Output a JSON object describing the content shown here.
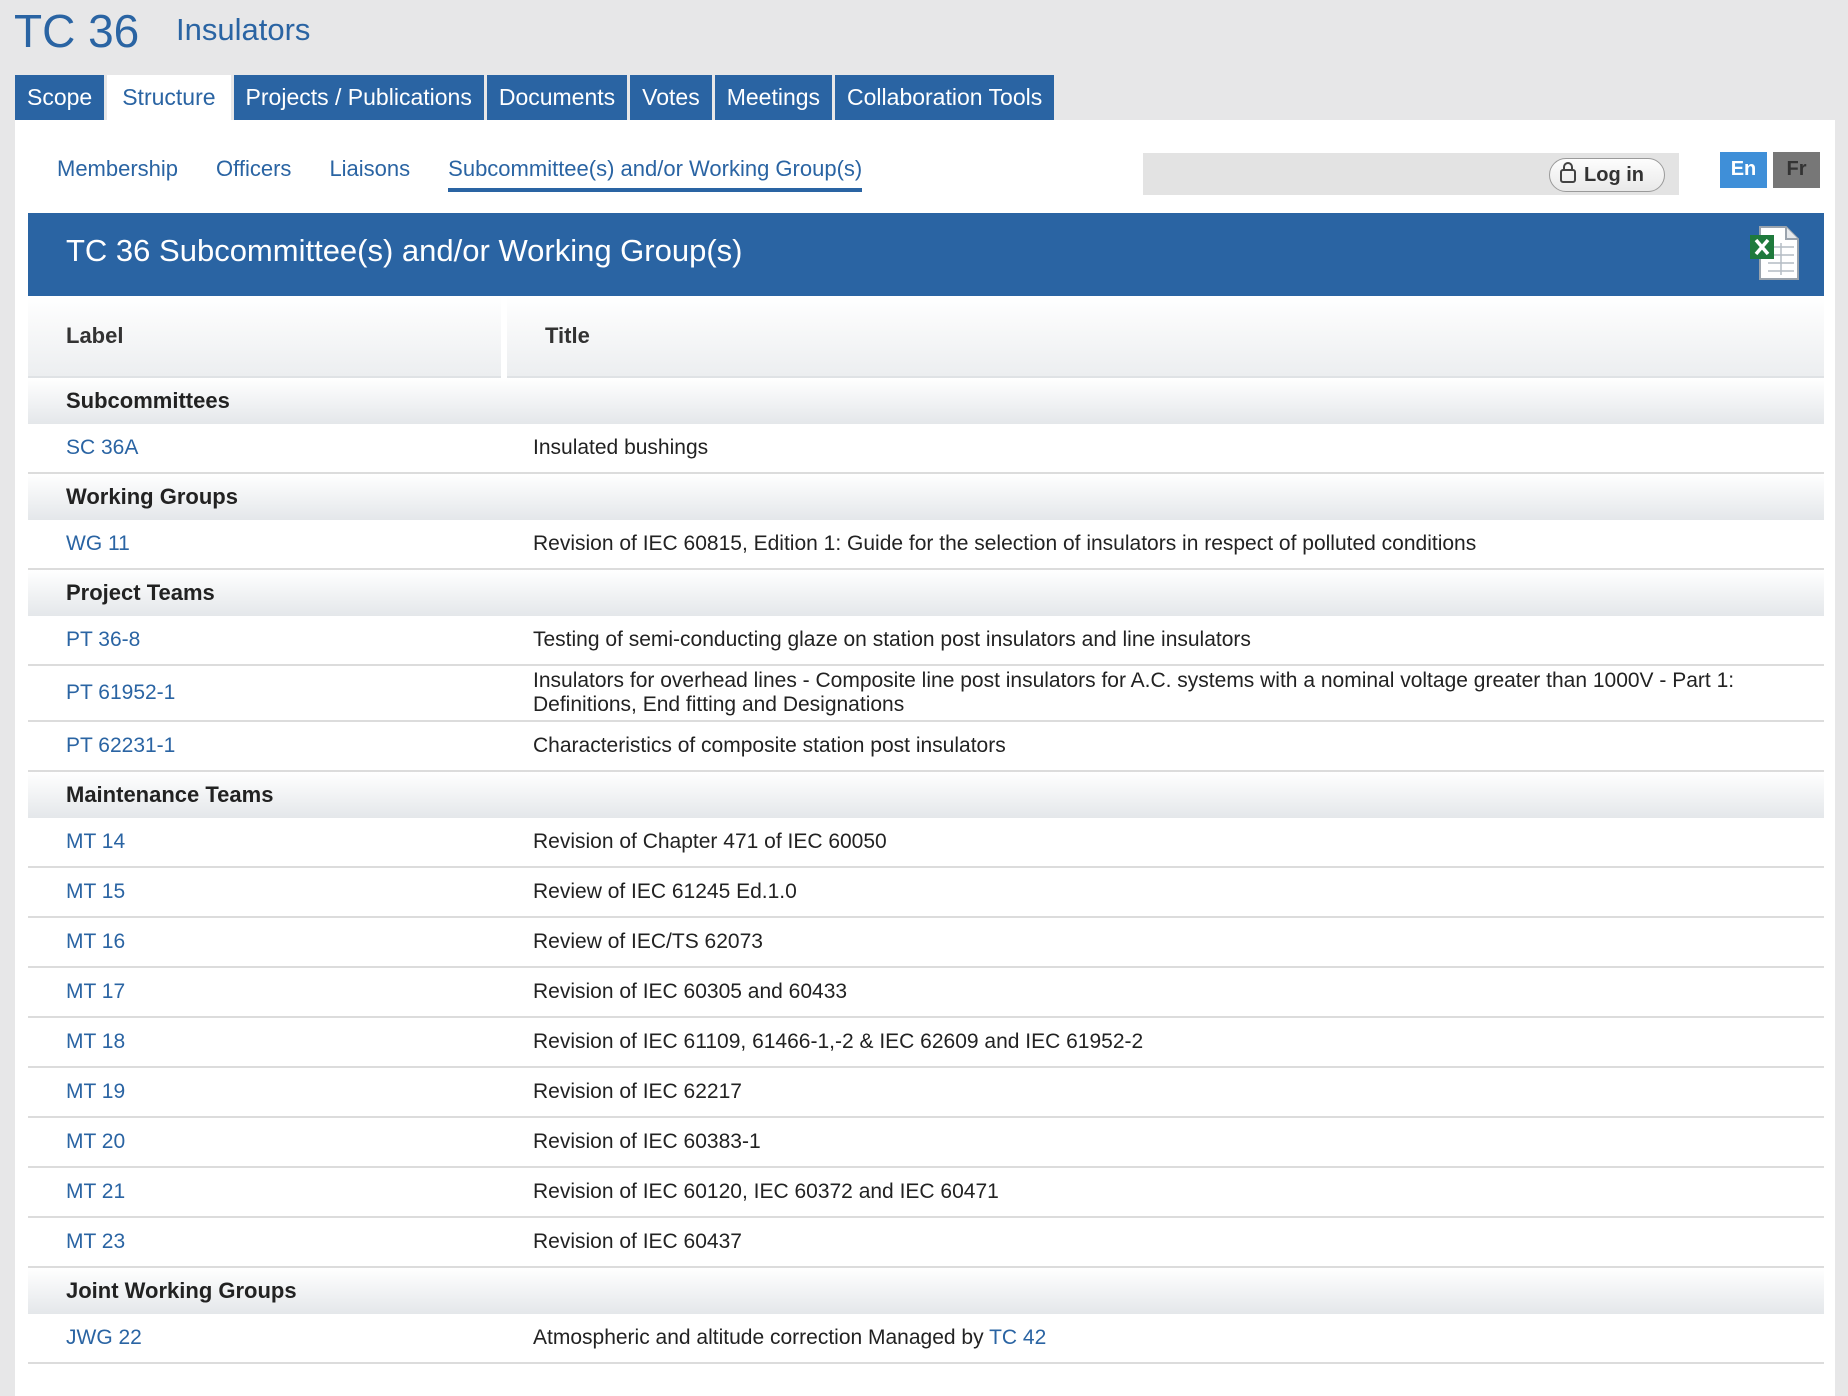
{
  "header": {
    "code": "TC 36",
    "name": "Insulators"
  },
  "tabs": [
    "Scope",
    "Structure",
    "Projects / Publications",
    "Documents",
    "Votes",
    "Meetings",
    "Collaboration Tools"
  ],
  "subnav": [
    "Membership",
    "Officers",
    "Liaisons",
    "Subcommittee(s) and/or Working Group(s)"
  ],
  "login": {
    "label": "Log in"
  },
  "languages": {
    "en": "En",
    "fr": "Fr"
  },
  "section_title": "TC 36 Subcommittee(s) and/or Working Group(s)",
  "table": {
    "headers": {
      "label": "Label",
      "title": "Title"
    },
    "groups": {
      "subcommittees": "Subcommittees",
      "working_groups": "Working Groups",
      "project_teams": "Project Teams",
      "maintenance_teams": "Maintenance Teams",
      "joint_working_groups": "Joint Working Groups"
    },
    "rows": {
      "sc36a": {
        "label": "SC 36A",
        "title": "Insulated bushings"
      },
      "wg11": {
        "label": "WG 11",
        "title": "Revision of IEC 60815, Edition 1: Guide for the selection of insulators in respect of polluted conditions"
      },
      "pt36_8": {
        "label": "PT 36-8",
        "title": "Testing of semi-conducting glaze on station post insulators and line insulators"
      },
      "pt61952": {
        "label": "PT 61952-1",
        "title": "Insulators for overhead lines - Composite line post insulators for A.C. systems with a nominal voltage greater than 1000V - Part 1: Definitions, End fitting and Designations"
      },
      "pt62231": {
        "label": "PT 62231-1",
        "title": "Characteristics of composite station post insulators"
      },
      "mt14": {
        "label": "MT 14",
        "title": "Revision of Chapter 471 of IEC 60050"
      },
      "mt15": {
        "label": "MT 15",
        "title": "Review of IEC 61245 Ed.1.0"
      },
      "mt16": {
        "label": "MT 16",
        "title": "Review of IEC/TS 62073"
      },
      "mt17": {
        "label": "MT 17",
        "title": "Revision of IEC 60305 and 60433"
      },
      "mt18": {
        "label": "MT 18",
        "title": "Revision of IEC 61109, 61466-1,-2 & IEC 62609 and IEC 61952-2"
      },
      "mt19": {
        "label": "MT 19",
        "title": "Revision of IEC 62217"
      },
      "mt20": {
        "label": "MT 20",
        "title": "Revision of IEC 60383-1"
      },
      "mt21": {
        "label": "MT 21",
        "title": "Revision of IEC 60120, IEC 60372 and IEC 60471"
      },
      "mt23": {
        "label": "MT 23",
        "title": "Revision of IEC 60437"
      },
      "jwg22": {
        "label": "JWG 22",
        "title": "Atmospheric and altitude correction Managed by",
        "link": "TC 42"
      }
    }
  }
}
